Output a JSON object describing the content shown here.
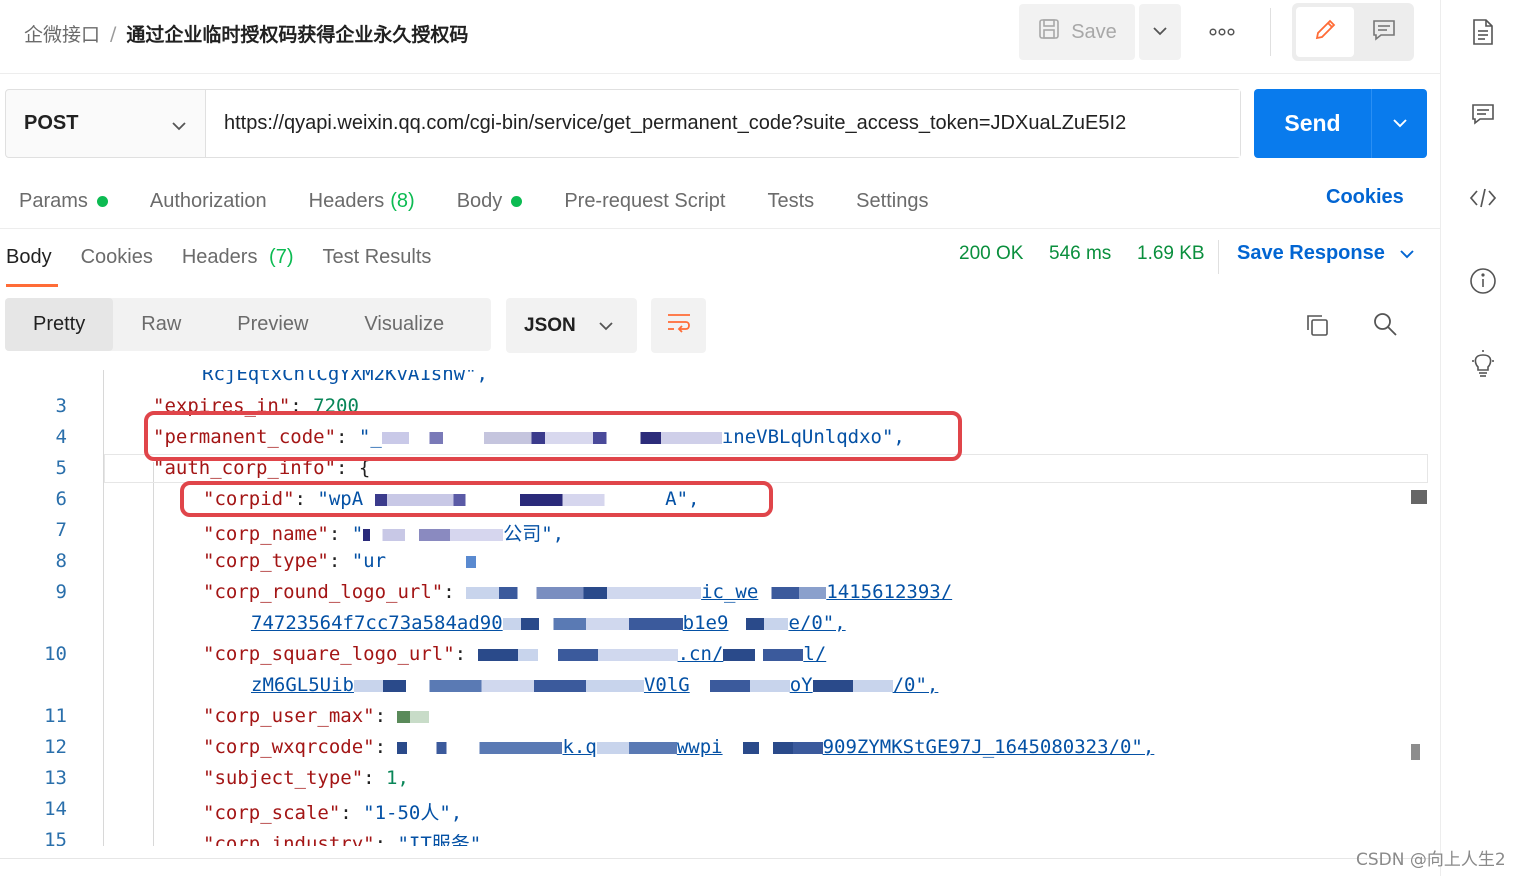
{
  "breadcrumb": {
    "parent": "企微接口",
    "separator": "/",
    "current": "通过企业临时授权码获得企业永久授权码"
  },
  "toolbar": {
    "save_label": "Save"
  },
  "request": {
    "method": "POST",
    "url": "https://qyapi.weixin.qq.com/cgi-bin/service/get_permanent_code?suite_access_token=JDXuaLZuE5I2",
    "send_label": "Send"
  },
  "request_tabs": [
    {
      "label": "Params",
      "dot": true
    },
    {
      "label": "Authorization"
    },
    {
      "label": "Headers",
      "count": "(8)"
    },
    {
      "label": "Body",
      "dot": true
    },
    {
      "label": "Pre-request Script"
    },
    {
      "label": "Tests"
    },
    {
      "label": "Settings"
    }
  ],
  "cookies_label": "Cookies",
  "response_tabs": [
    {
      "label": "Body"
    },
    {
      "label": "Cookies"
    },
    {
      "label": "Headers",
      "count": "(7)"
    },
    {
      "label": "Test Results"
    }
  ],
  "response_status": {
    "code": "200 OK",
    "time": "546 ms",
    "size": "1.69 KB"
  },
  "save_response_label": "Save Response",
  "view_options": [
    "Pretty",
    "Raw",
    "Preview",
    "Visualize"
  ],
  "format": "JSON",
  "code_lines": {
    "top_partial": "RcjEqtxChlCgYXM2KvA1snw\",",
    "l3": {
      "no": "3",
      "key": "\"expires_in\"",
      "value": "7200"
    },
    "l4": {
      "no": "4",
      "key": "\"permanent_code\"",
      "value_start": "\"_",
      "value_end": "ıneVBLqUnlqdxo\","
    },
    "l5": {
      "no": "5",
      "key": "\"auth_corp_info\"",
      "value": "{"
    },
    "l6": {
      "no": "6",
      "key": "\"corpid\"",
      "value_start": "\"wpA",
      "value_end": "A\","
    },
    "l7": {
      "no": "7",
      "key": "\"corp_name\"",
      "value_start": "\"",
      "value_end": "公司\","
    },
    "l8": {
      "no": "8",
      "key": "\"corp_type\"",
      "value_start": "\"ur"
    },
    "l9": {
      "no": "9",
      "key": "\"corp_round_logo_url\"",
      "value_a": "ic_we",
      "value_b": "1415612393/",
      "value_c": "74723564f7cc73a584ad90",
      "value_d": "b1e9",
      "value_e": "e/0\","
    },
    "l10": {
      "no": "10",
      "key": "\"corp_square_logo_url\"",
      "value_a": ".cn/",
      "value_b": "l/",
      "value_c": "zM6GL5Uib",
      "value_d": "V0lG",
      "value_e": "oY",
      "value_f": "/0\","
    },
    "l11": {
      "no": "11",
      "key": "\"corp_user_max\""
    },
    "l12": {
      "no": "12",
      "key": "\"corp_wxqrcode\"",
      "value_a": "k.q",
      "value_b": "wwpi",
      "value_c": "909ZYMKStGE97J_1645080323/0\","
    },
    "l13": {
      "no": "13",
      "key": "\"subject_type\"",
      "value": "1,"
    },
    "l14": {
      "no": "14",
      "key": "\"corp_scale\"",
      "value": "\"1-50人\","
    },
    "l15": {
      "no": "15",
      "key": "\"corp_industry\"",
      "value": "\"IT服务\""
    }
  },
  "watermark": "CSDN @向上人生2",
  "icons": {
    "save": "save-icon",
    "more": "more-icon",
    "edit": "pencil-icon",
    "docs": "comment-icon",
    "sidebar": [
      "document-icon",
      "comment-icon",
      "code-icon",
      "info-icon",
      "lightbulb-icon"
    ]
  },
  "colors": {
    "accent": "#097bed",
    "tab_underline": "#ff6c37",
    "success": "#0cbb52",
    "highlight_box": "#e0454a"
  }
}
